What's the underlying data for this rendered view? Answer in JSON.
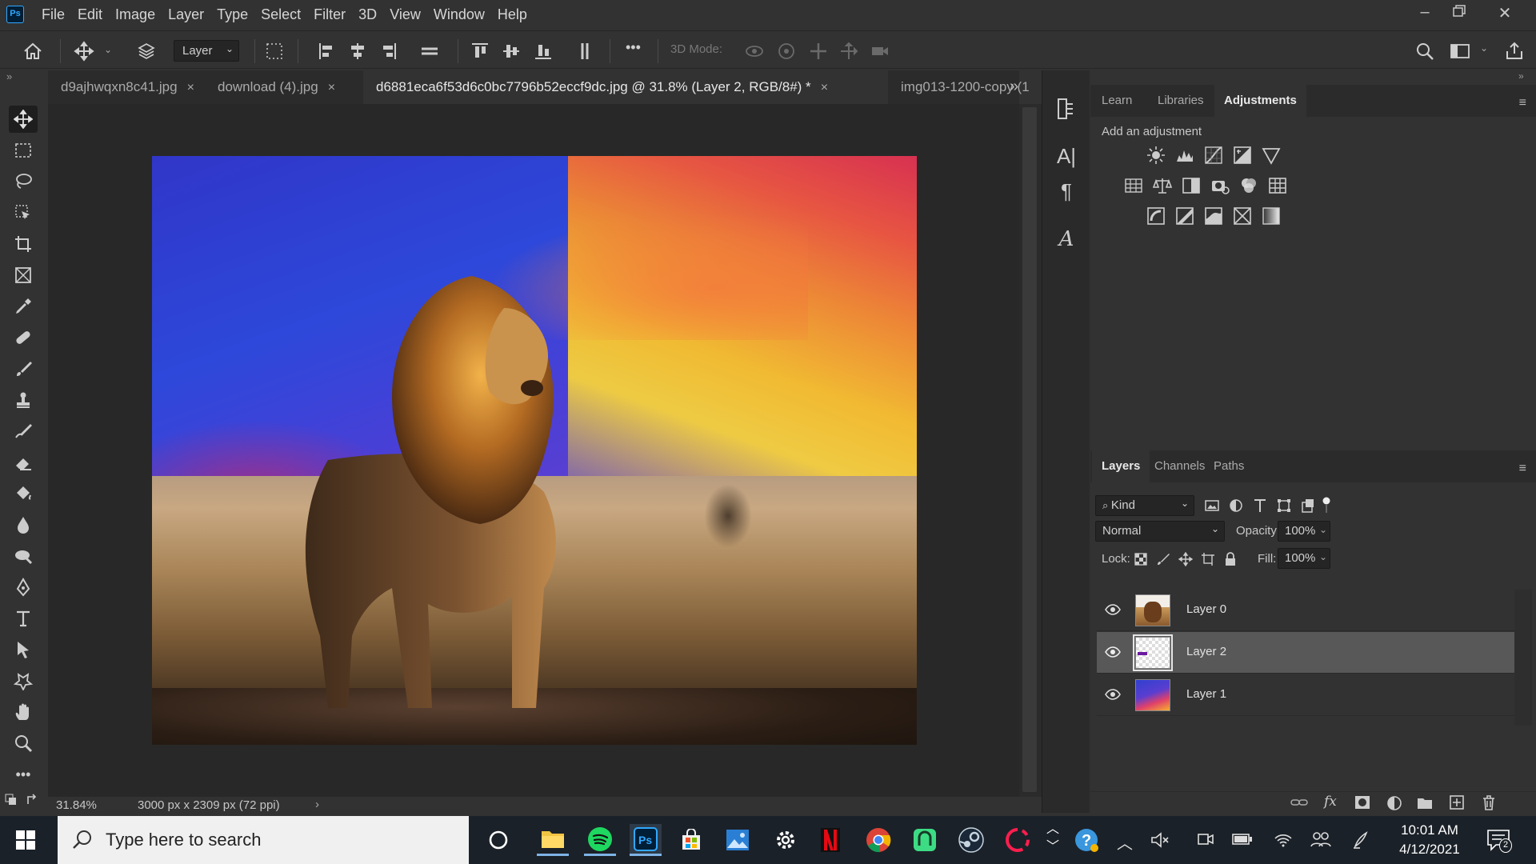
{
  "app": {
    "logo": "Ps",
    "name": "Adobe Photoshop"
  },
  "menu": [
    "File",
    "Edit",
    "Image",
    "Layer",
    "Type",
    "Select",
    "Filter",
    "3D",
    "View",
    "Window",
    "Help"
  ],
  "options": {
    "home_icon": "home-icon",
    "move_icon": "move-tool-icon",
    "auto_select_value": "Layer",
    "mode_3d_label": "3D Mode:",
    "more": "•••"
  },
  "tabs": [
    {
      "label": "d9ajhwqxn8c41.jpg",
      "close": "×",
      "active": false
    },
    {
      "label": "download (4).jpg",
      "close": "×",
      "active": false
    },
    {
      "label": "d6881eca6f53d6c0bc7796b52eccf9dc.jpg @ 31.8% (Layer 2, RGB/8#) *",
      "close": "×",
      "active": true
    },
    {
      "label": "img013-1200-copy (1",
      "close": "",
      "active": false
    }
  ],
  "tab_overflow": "»",
  "status": {
    "zoom": "31.84%",
    "doc_info": "3000 px x 2309 px (72 ppi)",
    "arrow": "›"
  },
  "tools": [
    "move-tool",
    "marquee-tool",
    "lasso-tool",
    "object-select-tool",
    "crop-tool",
    "frame-tool",
    "eyedropper-tool",
    "healing-brush-tool",
    "brush-tool",
    "clone-stamp-tool",
    "history-brush-tool",
    "eraser-tool",
    "paint-bucket-tool",
    "blur-tool",
    "dodge-tool",
    "pen-tool",
    "type-tool",
    "path-select-tool",
    "shape-tool",
    "hand-tool",
    "zoom-tool",
    "more-tools"
  ],
  "adjustments": {
    "tabs": [
      "Learn",
      "Libraries",
      "Adjustments"
    ],
    "active_tab": "Adjustments",
    "heading": "Add an adjustment",
    "icons_row1": [
      "brightness-contrast-icon",
      "levels-icon",
      "curves-icon",
      "exposure-icon",
      "vibrance-icon"
    ],
    "icons_row2": [
      "hue-saturation-icon",
      "color-balance-icon",
      "black-white-icon",
      "photo-filter-icon",
      "channel-mixer-icon",
      "color-lookup-icon"
    ],
    "icons_row3": [
      "invert-icon",
      "posterize-icon",
      "threshold-icon",
      "selective-color-icon",
      "gradient-map-icon"
    ]
  },
  "layers_panel": {
    "tabs": [
      "Layers",
      "Channels",
      "Paths"
    ],
    "active_tab": "Layers",
    "filter_label": "Kind",
    "blend_mode": "Normal",
    "opacity_label": "Opacity:",
    "opacity_value": "100%",
    "lock_label": "Lock:",
    "fill_label": "Fill:",
    "fill_value": "100%",
    "layers": [
      {
        "name": "Layer 0",
        "selected": false,
        "thumb": "lion"
      },
      {
        "name": "Layer 2",
        "selected": true,
        "thumb": "transparent-strokes"
      },
      {
        "name": "Layer 1",
        "selected": false,
        "thumb": "sunset-sky"
      }
    ],
    "footer_icons": [
      "link-layers-icon",
      "fx-icon",
      "add-mask-icon",
      "adjustment-layer-icon",
      "group-icon",
      "new-layer-icon",
      "delete-icon"
    ]
  },
  "taskbar": {
    "search_placeholder": "Type here to search",
    "apps": [
      "cortana-icon",
      "file-explorer-icon",
      "spotify-icon",
      "photoshop-icon",
      "store-icon",
      "photos-icon",
      "settings-icon",
      "netflix-icon",
      "chrome-icon",
      "android-app-icon",
      "steam-icon",
      "opera-gx-icon"
    ],
    "time": "10:01 AM",
    "date": "4/12/2021",
    "notification_count": "2"
  },
  "colors": {
    "ps_blue": "#31a8ff",
    "panel": "#323232",
    "canvas_bg": "#282828",
    "taskbar": "#1b2128"
  }
}
